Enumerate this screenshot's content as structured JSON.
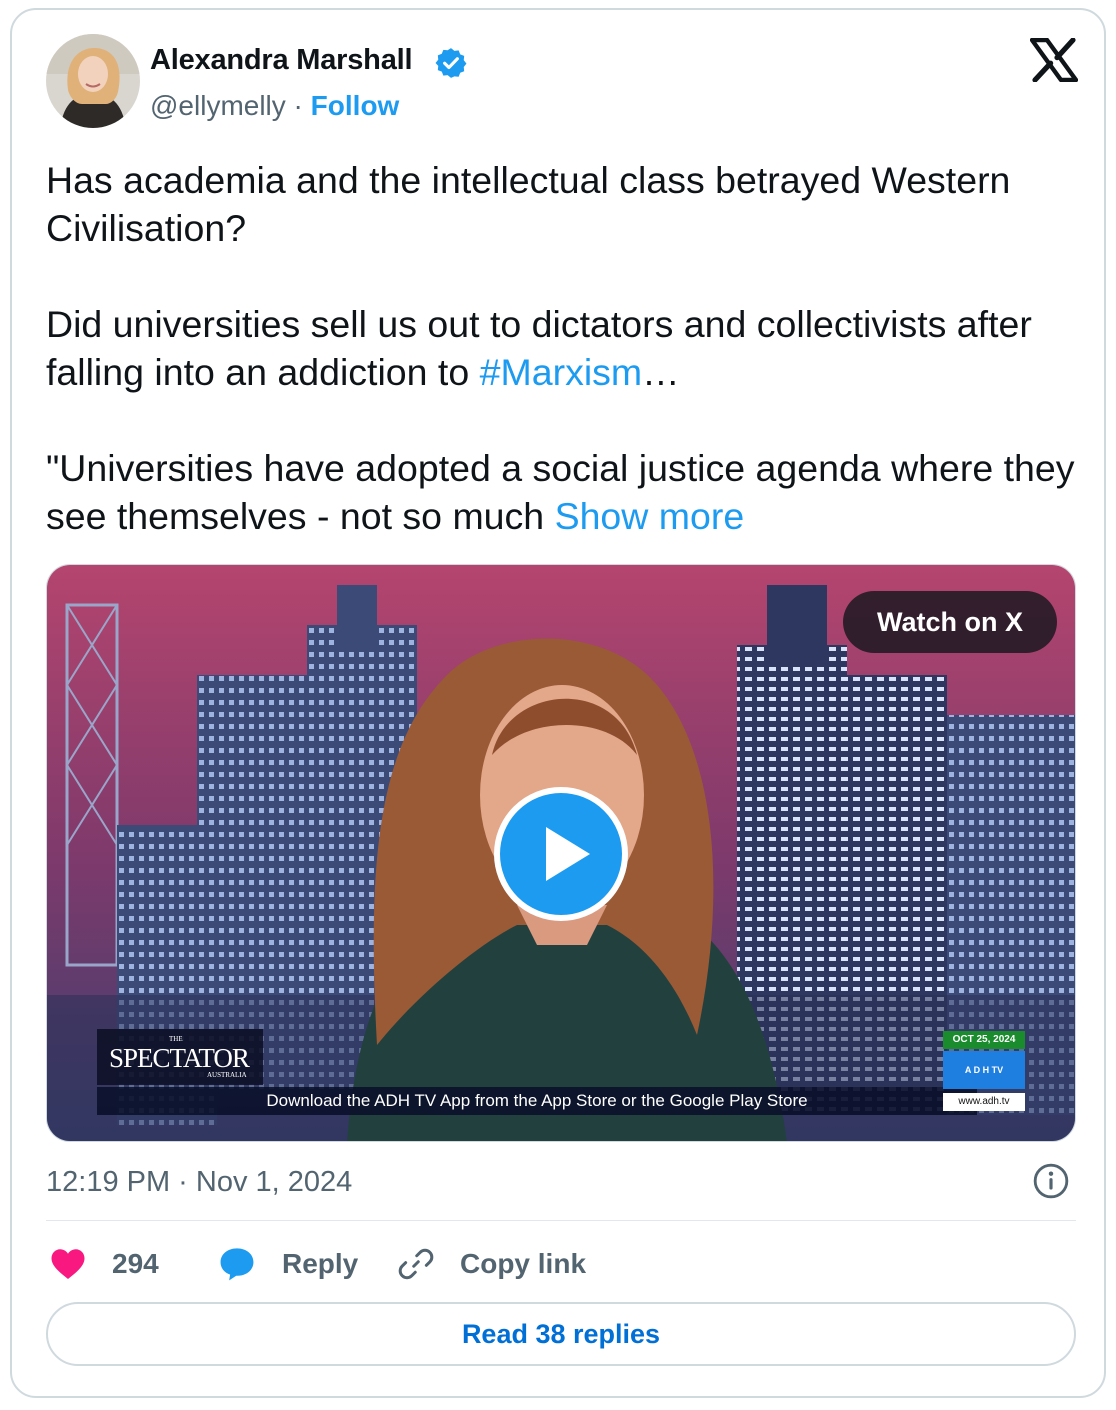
{
  "author": {
    "name": "Alexandra Marshall",
    "handle": "@ellymelly",
    "separator": " · ",
    "follow_label": "Follow",
    "verified_icon": "verified-badge-icon"
  },
  "platform_icon": "x-logo-icon",
  "tweet": {
    "paragraph1": "Has academia and the intellectual class betrayed Western Civilisation?",
    "paragraph2_start": "Did universities sell us out to dictators and collectivists after falling into an addiction to ",
    "hashtag": "#Marxism",
    "paragraph2_end": "…",
    "paragraph3_start": "\"Universities have adopted a social justice agenda where they see themselves - not so much ",
    "show_more": "Show more"
  },
  "media": {
    "watch_label": "Watch on X",
    "play_icon": "play-icon",
    "spectator_top": "THE",
    "spectator_main": "SPECTATOR",
    "spectator_bottom": "AUSTRALIA",
    "ticker": "Download the ADH TV App from the App Store or the Google Play Store",
    "adh_date": "OCT 25, 2024",
    "adh_logo": "A D H  TV",
    "adh_url": "www.adh.tv"
  },
  "meta": {
    "timestamp": "12:19 PM · Nov 1, 2024",
    "info_icon": "info-icon"
  },
  "actions": {
    "likes_count": "294",
    "reply_label": "Reply",
    "copy_link_label": "Copy link"
  },
  "read_replies_label": "Read 38 replies",
  "colors": {
    "accent": "#1d9bf0",
    "like": "#f91880",
    "text": "#0f1419",
    "muted": "#536471",
    "border": "#cfd9de"
  }
}
